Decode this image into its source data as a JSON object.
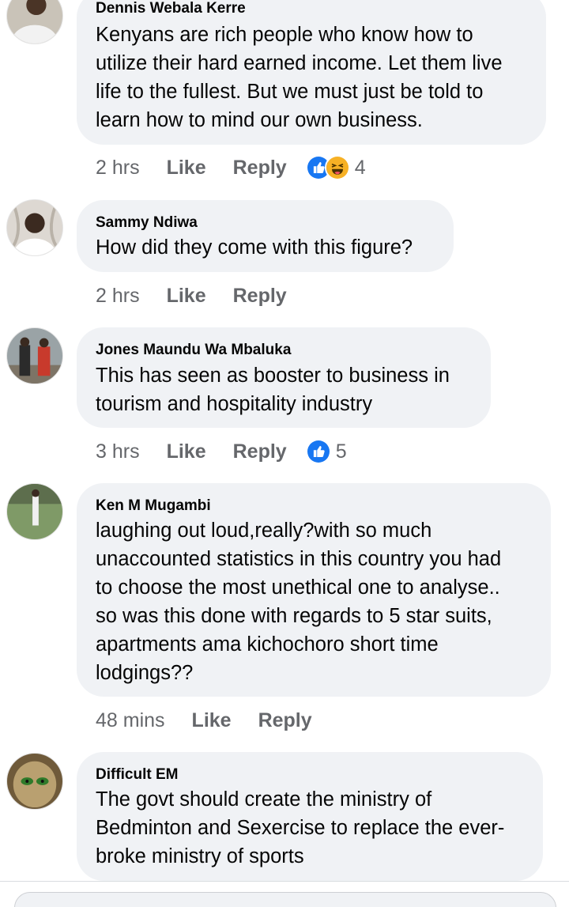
{
  "comments": [
    {
      "author": "Dennis Webala Kerre",
      "text": "Kenyans are rich people who know how to\nutilize their hard earned income. Let them live\nlife to the fullest. But we must just be told to\nlearn how to mind our own business.",
      "time": "2 hrs",
      "like_label": "Like",
      "reply_label": "Reply",
      "reactions": [
        "like-icon",
        "haha-icon"
      ],
      "reaction_count": "4"
    },
    {
      "author": "Sammy Ndiwa",
      "text": "How did they come with this figure?",
      "time": "2 hrs",
      "like_label": "Like",
      "reply_label": "Reply"
    },
    {
      "author": "Jones Maundu Wa Mbaluka",
      "text": "This has seen as booster to business in\ntourism and hospitality industry",
      "time": "3 hrs",
      "like_label": "Like",
      "reply_label": "Reply",
      "reactions": [
        "like-icon"
      ],
      "reaction_count": "5"
    },
    {
      "author": "Ken M Mugambi",
      "text": "laughing out loud,really?with so much\nunaccounted statistics in this country you had\nto choose the most unethical one to analyse..\nso was this done with regards to 5 star suits,\napartments ama kichochoro short time\nlodgings??",
      "time": "48 mins",
      "like_label": "Like",
      "reply_label": "Reply"
    },
    {
      "author": "Difficult EM",
      "text": "The govt should create the ministry of\nBedminton and Sexercise to replace the ever-\nbroke ministry of sports"
    }
  ],
  "colors": {
    "bubble_bg": "#f0f2f5",
    "secondary_text": "#65676b",
    "like_blue": "#1877f2",
    "haha_yellow": "#f7b125"
  }
}
